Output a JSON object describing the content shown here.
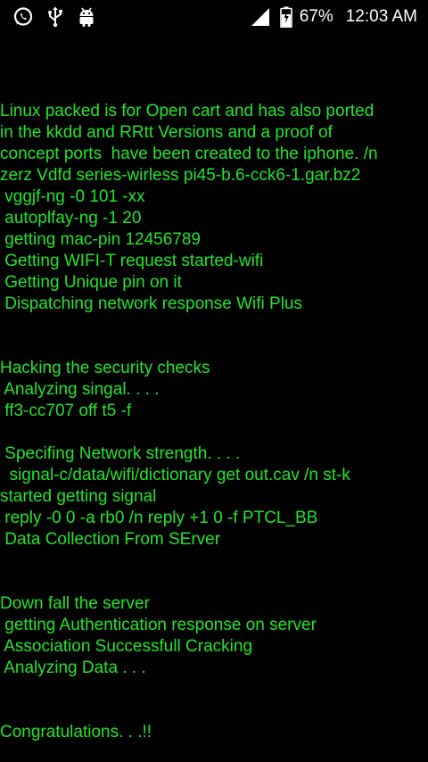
{
  "status_bar": {
    "left_icons": [
      "whatsapp-icon",
      "usb-icon",
      "android-icon"
    ],
    "battery_percent": "67%",
    "time": "12:03 AM"
  },
  "terminal": {
    "text_color": "#22e52a",
    "lines": [
      "Linux packed is for Open cart and has also ported",
      "in the kkdd and RRtt Versions and a proof of",
      "concept ports  have been created to the iphone. /n",
      "zerz Vdfd series-wirless pi45-b.6-cck6-1.gar.bz2",
      " vggjf-ng -0 101 -xx",
      " autoplfay-ng -1 20",
      " getting mac-pin 12456789",
      " Getting WIFI-T request started-wifi",
      " Getting Unique pin on it",
      " Dispatching network response Wifi Plus",
      "",
      "",
      "Hacking the security checks",
      " Analyzing singal. . . .",
      " ff3-cc707 off t5 -f",
      "",
      " Specifing Network strength. . . .",
      "  signal-c/data/wifi/dictionary get out.cav /n st-k",
      "started getting signal",
      " reply -0 0 -a rb0 /n reply +1 0 -f PTCL_BB",
      " Data Collection From SErver",
      "",
      "",
      "Down fall the server",
      " getting Authentication response on server",
      " Association Successfull Cracking",
      " Analyzing Data . . .",
      "",
      "",
      "Congratulations. . .!!"
    ]
  }
}
